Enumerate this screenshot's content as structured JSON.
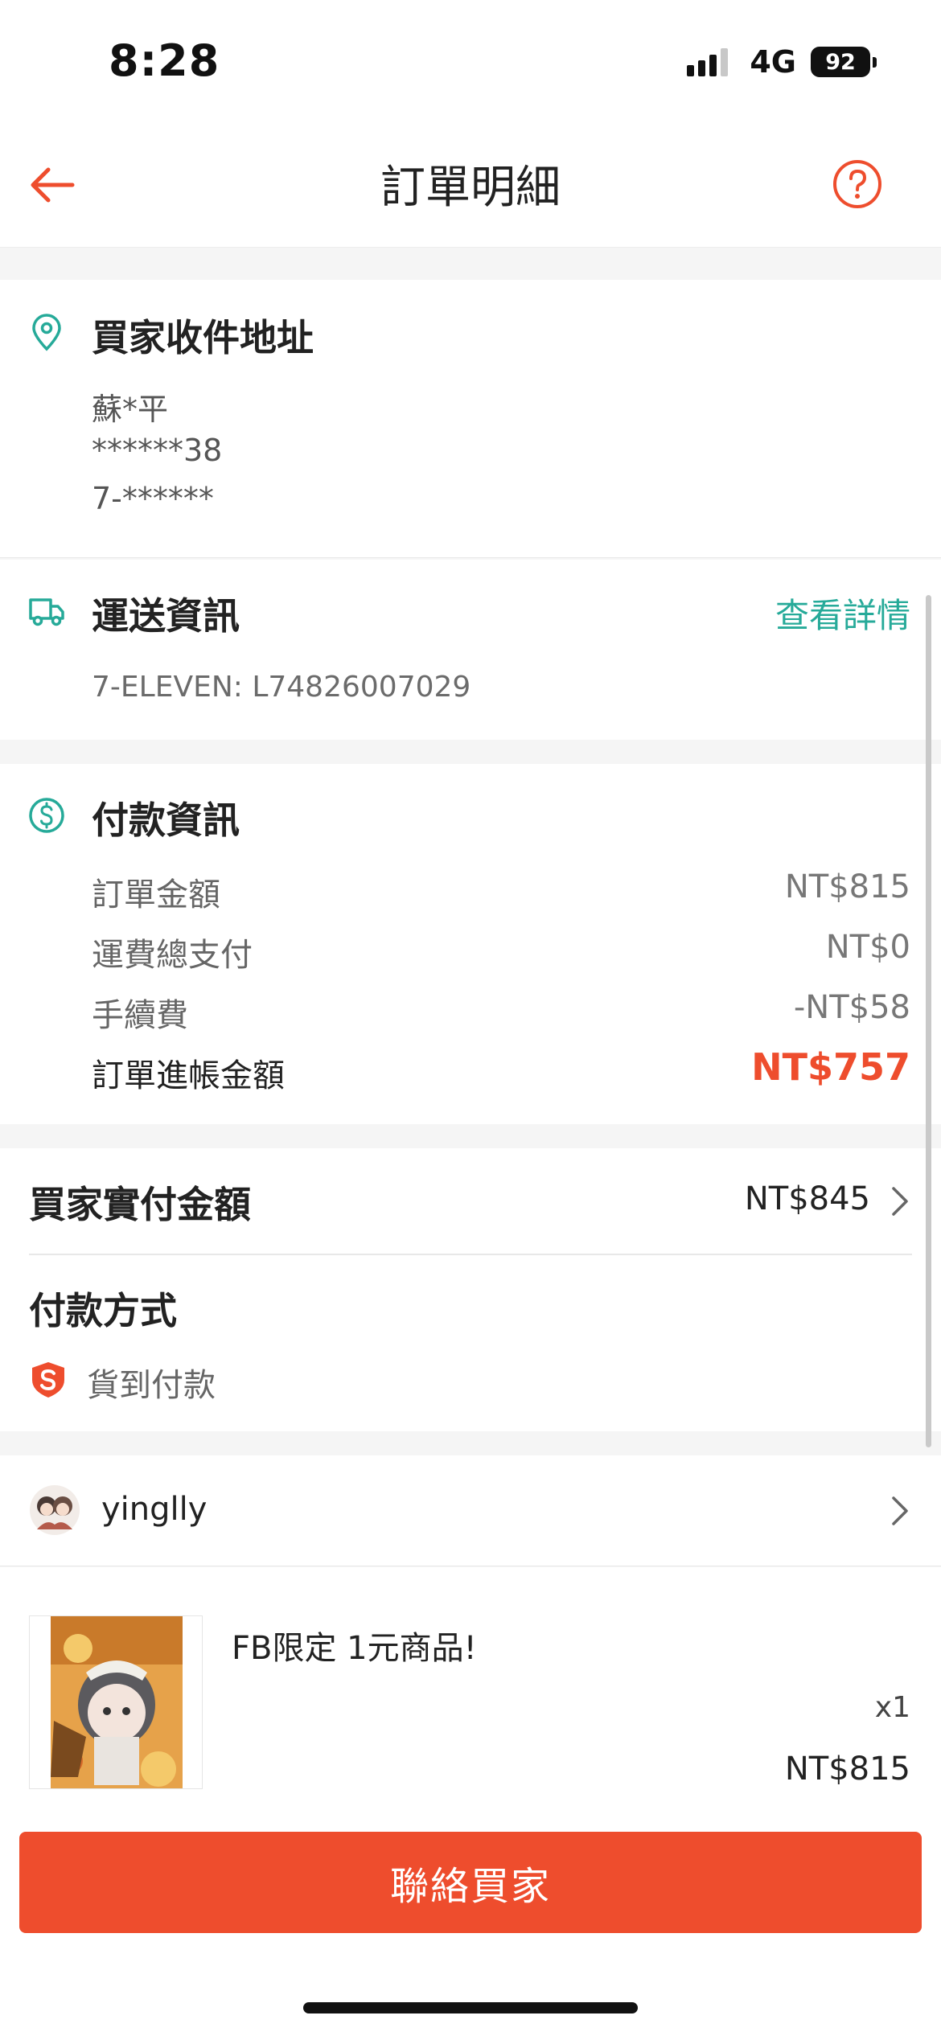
{
  "status": {
    "time": "8:28",
    "network": "4G",
    "battery": "92"
  },
  "nav": {
    "title": "訂單明細",
    "back_icon": "arrow-left-icon",
    "help_icon": "question-circle-icon"
  },
  "address": {
    "title": "買家收件地址",
    "name": "蘇*平",
    "phone": "******38",
    "detail": "7-******"
  },
  "shipping": {
    "title": "運送資訊",
    "details_link": "查看詳情",
    "tracking": "7-ELEVEN: L74826007029"
  },
  "payment": {
    "title": "付款資訊",
    "rows": [
      {
        "label": "訂單金額",
        "value": "NT$815"
      },
      {
        "label": "運費總支付",
        "value": "NT$0"
      },
      {
        "label": "手續費",
        "value": "-NT$58"
      }
    ],
    "total_label": "訂單進帳金額",
    "total_value": "NT$757"
  },
  "buyer_paid": {
    "label": "買家實付金額",
    "value": "NT$845"
  },
  "payment_method": {
    "title": "付款方式",
    "method": "貨到付款"
  },
  "buyer": {
    "username": "yinglly"
  },
  "product": {
    "name": "FB限定 1元商品!",
    "quantity": "x1",
    "price": "NT$815"
  },
  "actions": {
    "contact_label": "聯絡買家"
  },
  "colors": {
    "brand": "#ee4d2d",
    "teal": "#26aa99",
    "text": "#222222"
  }
}
